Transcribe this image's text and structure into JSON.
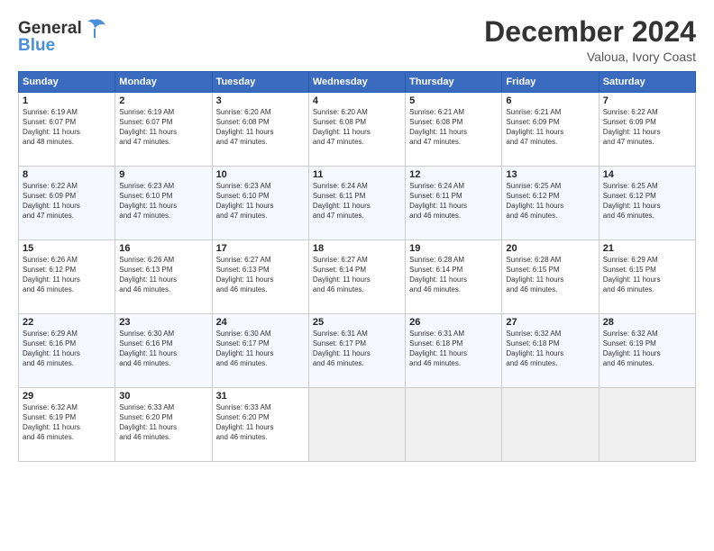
{
  "header": {
    "logo_line1": "General",
    "logo_line2": "Blue",
    "month_title": "December 2024",
    "subtitle": "Valoua, Ivory Coast"
  },
  "days_of_week": [
    "Sunday",
    "Monday",
    "Tuesday",
    "Wednesday",
    "Thursday",
    "Friday",
    "Saturday"
  ],
  "weeks": [
    [
      {
        "day": "1",
        "info": "Sunrise: 6:19 AM\nSunset: 6:07 PM\nDaylight: 11 hours\nand 48 minutes."
      },
      {
        "day": "2",
        "info": "Sunrise: 6:19 AM\nSunset: 6:07 PM\nDaylight: 11 hours\nand 47 minutes."
      },
      {
        "day": "3",
        "info": "Sunrise: 6:20 AM\nSunset: 6:08 PM\nDaylight: 11 hours\nand 47 minutes."
      },
      {
        "day": "4",
        "info": "Sunrise: 6:20 AM\nSunset: 6:08 PM\nDaylight: 11 hours\nand 47 minutes."
      },
      {
        "day": "5",
        "info": "Sunrise: 6:21 AM\nSunset: 6:08 PM\nDaylight: 11 hours\nand 47 minutes."
      },
      {
        "day": "6",
        "info": "Sunrise: 6:21 AM\nSunset: 6:09 PM\nDaylight: 11 hours\nand 47 minutes."
      },
      {
        "day": "7",
        "info": "Sunrise: 6:22 AM\nSunset: 6:09 PM\nDaylight: 11 hours\nand 47 minutes."
      }
    ],
    [
      {
        "day": "8",
        "info": "Sunrise: 6:22 AM\nSunset: 6:09 PM\nDaylight: 11 hours\nand 47 minutes."
      },
      {
        "day": "9",
        "info": "Sunrise: 6:23 AM\nSunset: 6:10 PM\nDaylight: 11 hours\nand 47 minutes."
      },
      {
        "day": "10",
        "info": "Sunrise: 6:23 AM\nSunset: 6:10 PM\nDaylight: 11 hours\nand 47 minutes."
      },
      {
        "day": "11",
        "info": "Sunrise: 6:24 AM\nSunset: 6:11 PM\nDaylight: 11 hours\nand 47 minutes."
      },
      {
        "day": "12",
        "info": "Sunrise: 6:24 AM\nSunset: 6:11 PM\nDaylight: 11 hours\nand 46 minutes."
      },
      {
        "day": "13",
        "info": "Sunrise: 6:25 AM\nSunset: 6:12 PM\nDaylight: 11 hours\nand 46 minutes."
      },
      {
        "day": "14",
        "info": "Sunrise: 6:25 AM\nSunset: 6:12 PM\nDaylight: 11 hours\nand 46 minutes."
      }
    ],
    [
      {
        "day": "15",
        "info": "Sunrise: 6:26 AM\nSunset: 6:12 PM\nDaylight: 11 hours\nand 46 minutes."
      },
      {
        "day": "16",
        "info": "Sunrise: 6:26 AM\nSunset: 6:13 PM\nDaylight: 11 hours\nand 46 minutes."
      },
      {
        "day": "17",
        "info": "Sunrise: 6:27 AM\nSunset: 6:13 PM\nDaylight: 11 hours\nand 46 minutes."
      },
      {
        "day": "18",
        "info": "Sunrise: 6:27 AM\nSunset: 6:14 PM\nDaylight: 11 hours\nand 46 minutes."
      },
      {
        "day": "19",
        "info": "Sunrise: 6:28 AM\nSunset: 6:14 PM\nDaylight: 11 hours\nand 46 minutes."
      },
      {
        "day": "20",
        "info": "Sunrise: 6:28 AM\nSunset: 6:15 PM\nDaylight: 11 hours\nand 46 minutes."
      },
      {
        "day": "21",
        "info": "Sunrise: 6:29 AM\nSunset: 6:15 PM\nDaylight: 11 hours\nand 46 minutes."
      }
    ],
    [
      {
        "day": "22",
        "info": "Sunrise: 6:29 AM\nSunset: 6:16 PM\nDaylight: 11 hours\nand 46 minutes."
      },
      {
        "day": "23",
        "info": "Sunrise: 6:30 AM\nSunset: 6:16 PM\nDaylight: 11 hours\nand 46 minutes."
      },
      {
        "day": "24",
        "info": "Sunrise: 6:30 AM\nSunset: 6:17 PM\nDaylight: 11 hours\nand 46 minutes."
      },
      {
        "day": "25",
        "info": "Sunrise: 6:31 AM\nSunset: 6:17 PM\nDaylight: 11 hours\nand 46 minutes."
      },
      {
        "day": "26",
        "info": "Sunrise: 6:31 AM\nSunset: 6:18 PM\nDaylight: 11 hours\nand 46 minutes."
      },
      {
        "day": "27",
        "info": "Sunrise: 6:32 AM\nSunset: 6:18 PM\nDaylight: 11 hours\nand 46 minutes."
      },
      {
        "day": "28",
        "info": "Sunrise: 6:32 AM\nSunset: 6:19 PM\nDaylight: 11 hours\nand 46 minutes."
      }
    ],
    [
      {
        "day": "29",
        "info": "Sunrise: 6:32 AM\nSunset: 6:19 PM\nDaylight: 11 hours\nand 46 minutes."
      },
      {
        "day": "30",
        "info": "Sunrise: 6:33 AM\nSunset: 6:20 PM\nDaylight: 11 hours\nand 46 minutes."
      },
      {
        "day": "31",
        "info": "Sunrise: 6:33 AM\nSunset: 6:20 PM\nDaylight: 11 hours\nand 46 minutes."
      },
      null,
      null,
      null,
      null
    ]
  ]
}
